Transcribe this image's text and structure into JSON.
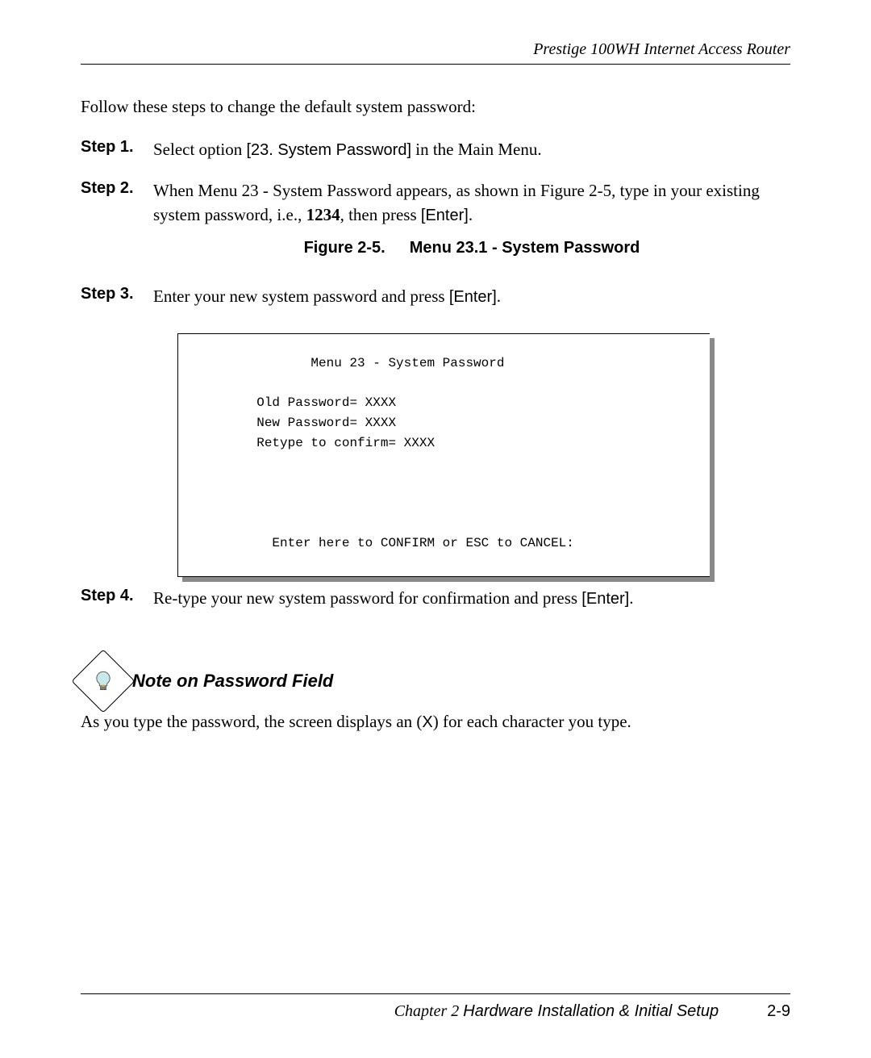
{
  "header": {
    "title": "Prestige 100WH Internet Access Router"
  },
  "intro": "Follow these steps to change the default system password:",
  "steps": [
    {
      "label": "Step 1.",
      "prefix": "Select option ",
      "menu_option": "[23. System Password]",
      "suffix": " in the Main Menu."
    },
    {
      "label": "Step 2.",
      "line1_a": "When Menu 23 - System Password appears, as shown in Figure 2-5, type in your existing system password, i.e., ",
      "bold": "1234",
      "line1_b": ", then press ",
      "enter": "[Enter]",
      "dot": "."
    },
    {
      "label": "Step 3.",
      "text": "Enter your new system password and press ",
      "enter": "[Enter]",
      "dot": "."
    },
    {
      "label": "Step 4.",
      "text": "Re-type your new system password for confirmation and press ",
      "enter": "[Enter]",
      "dot": "."
    }
  ],
  "figure": {
    "number": "Figure 2-5.",
    "title": "Menu 23.1 - System Password"
  },
  "terminal": {
    "title": "Menu 23 - System Password",
    "old": "Old Password= XXXX",
    "new": "New Password= XXXX",
    "retype": "Retype to confirm= XXXX",
    "prompt": "Enter here to CONFIRM or ESC to CANCEL:"
  },
  "note": {
    "title": "Note on Password Field",
    "text_a": "As you type the password, the screen displays an (",
    "x": "X",
    "text_b": ") for each character you type."
  },
  "footer": {
    "chapter_label": "Chapter 2 ",
    "chapter_title": "Hardware Installation & Initial Setup",
    "page": "2-9"
  }
}
